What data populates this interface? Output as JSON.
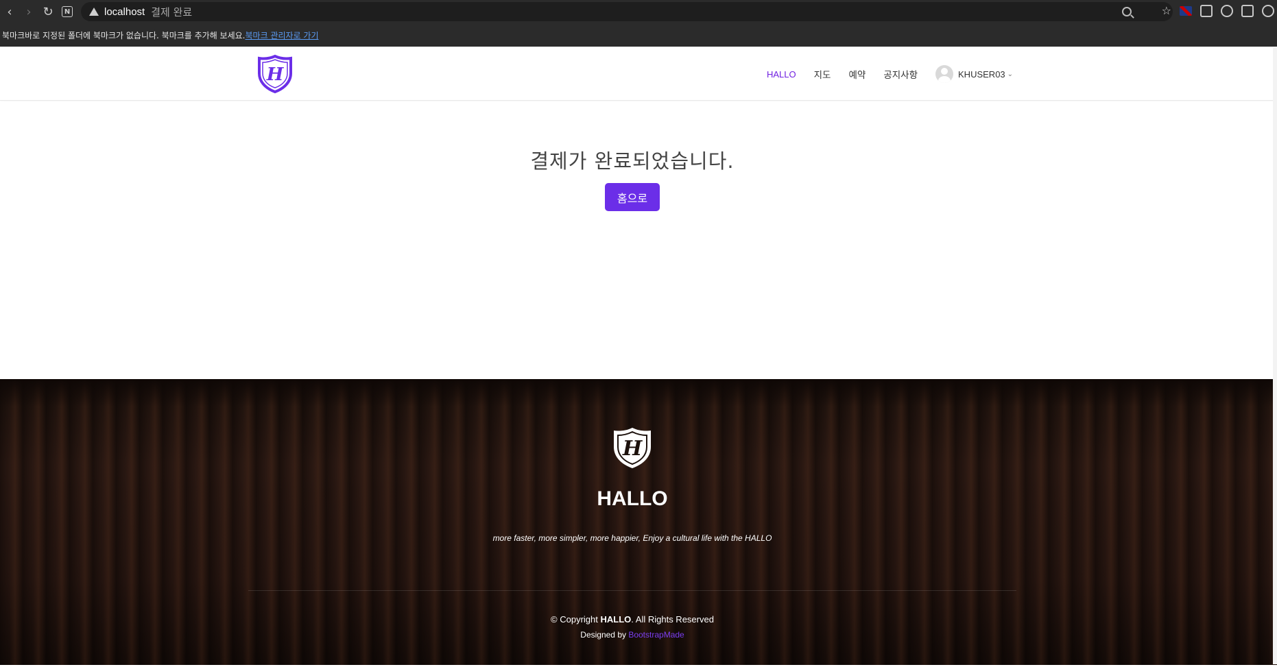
{
  "browser": {
    "url_host": "localhost",
    "url_title": "결제 완료",
    "bookmark_message": "북마크바로 지정된 폴더에 북마크가 없습니다. 북마크를 추가해 보세요.",
    "bookmark_link": "북마크 관리자로 가기"
  },
  "header": {
    "nav": [
      "HALLO",
      "지도",
      "예약",
      "공지사항"
    ],
    "username": "KHUSER03"
  },
  "main": {
    "message": "결제가 완료되었습니다.",
    "home_button": "홈으로"
  },
  "footer": {
    "title": "HALLO",
    "tagline": "more faster, more simpler, more happier, Enjoy a cultural life with the HALLO",
    "copyright_prefix": "© Copyright ",
    "copyright_brand": "HALLO",
    "copyright_suffix": ". All Rights Reserved",
    "designed_prefix": "Designed by ",
    "designed_link": "BootstrapMade"
  },
  "colors": {
    "accent": "#6b2ee8",
    "nav_active": "#6f1fe0"
  }
}
